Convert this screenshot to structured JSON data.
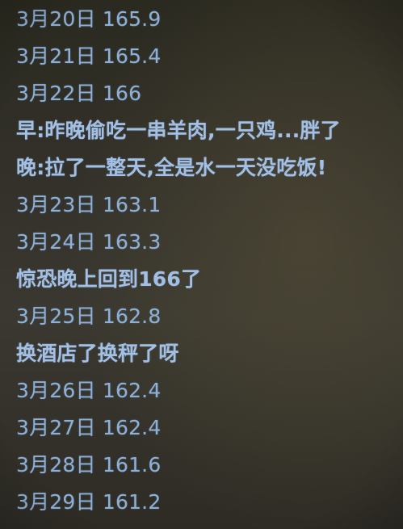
{
  "entries": [
    {
      "kind": "weight",
      "text": "3月20日 165.9"
    },
    {
      "kind": "weight",
      "text": "3月21日 165.4"
    },
    {
      "kind": "weight",
      "text": "3月22日 166"
    },
    {
      "kind": "note",
      "text": "早:昨晚偷吃一串羊肉,一只鸡...胖了"
    },
    {
      "kind": "note",
      "text": "晚:拉了一整天,全是水一天没吃饭!"
    },
    {
      "kind": "weight",
      "text": "3月23日 163.1"
    },
    {
      "kind": "weight",
      "text": "3月24日 163.3"
    },
    {
      "kind": "note",
      "text": "惊恐晚上回到166了"
    },
    {
      "kind": "weight",
      "text": "3月25日 162.8"
    },
    {
      "kind": "note",
      "text": "换酒店了换秤了呀"
    },
    {
      "kind": "weight",
      "text": "3月26日 162.4"
    },
    {
      "kind": "weight",
      "text": "3月27日 162.4"
    },
    {
      "kind": "weight",
      "text": "3月28日 161.6"
    },
    {
      "kind": "weight",
      "text": "3月29日 161.2"
    }
  ]
}
